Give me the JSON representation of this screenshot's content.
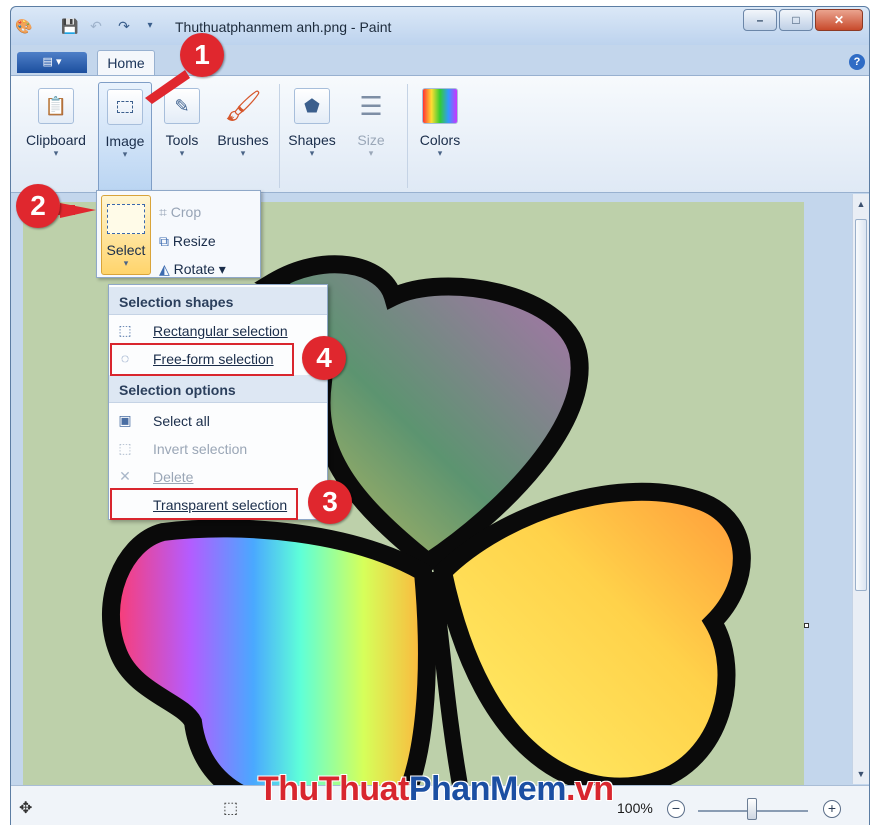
{
  "window": {
    "title": "Thuthuatphanmem anh.png - Paint",
    "minimize": "–",
    "maximize": "□",
    "close": "✕"
  },
  "tabs": {
    "app_menu": "▤ ▾",
    "home": "Home",
    "help": "?"
  },
  "ribbon": {
    "groups": [
      {
        "label": "Clipboard",
        "icon": "clipboard-icon",
        "glyph": "📋"
      },
      {
        "label": "Image",
        "icon": "select-rect-icon",
        "glyph": "⬚"
      },
      {
        "label": "Tools",
        "icon": "tools-icon",
        "glyph": "✎"
      },
      {
        "label": "Brushes",
        "icon": "brush-icon",
        "glyph": "🖌"
      },
      {
        "label": "Shapes",
        "icon": "shapes-icon",
        "glyph": "⬟"
      },
      {
        "label": "Size",
        "icon": "size-lines-icon",
        "glyph": "☰"
      },
      {
        "label": "Colors",
        "icon": "palette-icon",
        "glyph": "▦"
      }
    ],
    "dropdown_arrow": "▾"
  },
  "image_panel": {
    "select": "Select",
    "crop": "Crop",
    "resize": "Resize",
    "rotate": "Rotate ▾"
  },
  "select_menu": {
    "shapes_header": "Selection shapes",
    "rect": "Rectangular selection",
    "freeform": "Free-form selection",
    "options_header": "Selection options",
    "select_all": "Select all",
    "invert": "Invert selection",
    "delete": "Delete",
    "transparent": "Transparent selection"
  },
  "callouts": [
    "1",
    "2",
    "3",
    "4"
  ],
  "status": {
    "zoom": "100%",
    "zoom_out": "−",
    "zoom_in": "+",
    "zoom_level": 0.5
  },
  "watermark": {
    "part1": "ThuThuat",
    "part2": "PhanMem",
    "part3": ".vn"
  },
  "colors": {
    "accent_red": "#e0272e",
    "canvas_bg": "#bdd0aa",
    "ribbon_blue": "#c3d6ec"
  }
}
